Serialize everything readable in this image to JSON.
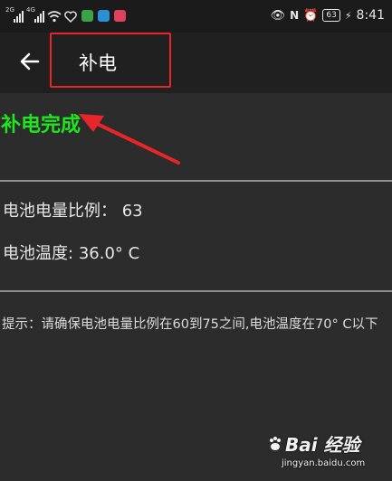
{
  "status_bar": {
    "sim1_gen": "2G",
    "sim2_gen": "4G",
    "battery": "63",
    "time": "8:41"
  },
  "toolbar": {
    "title": "补电"
  },
  "main": {
    "status_text": "补电完成",
    "battery_level_label": "电池电量比例：",
    "battery_level_value": "63",
    "battery_temp_label": "电池温度:",
    "battery_temp_value": "36.0° C",
    "hint": "提示：请确保电池电量比例在60到75之间,电池温度在70° C以下"
  },
  "watermark": {
    "logo": "Bai 经验",
    "url": "jingyan.baidu.com"
  },
  "colors": {
    "accent_green": "#1ee51e",
    "annotation_red": "#e8262a"
  }
}
